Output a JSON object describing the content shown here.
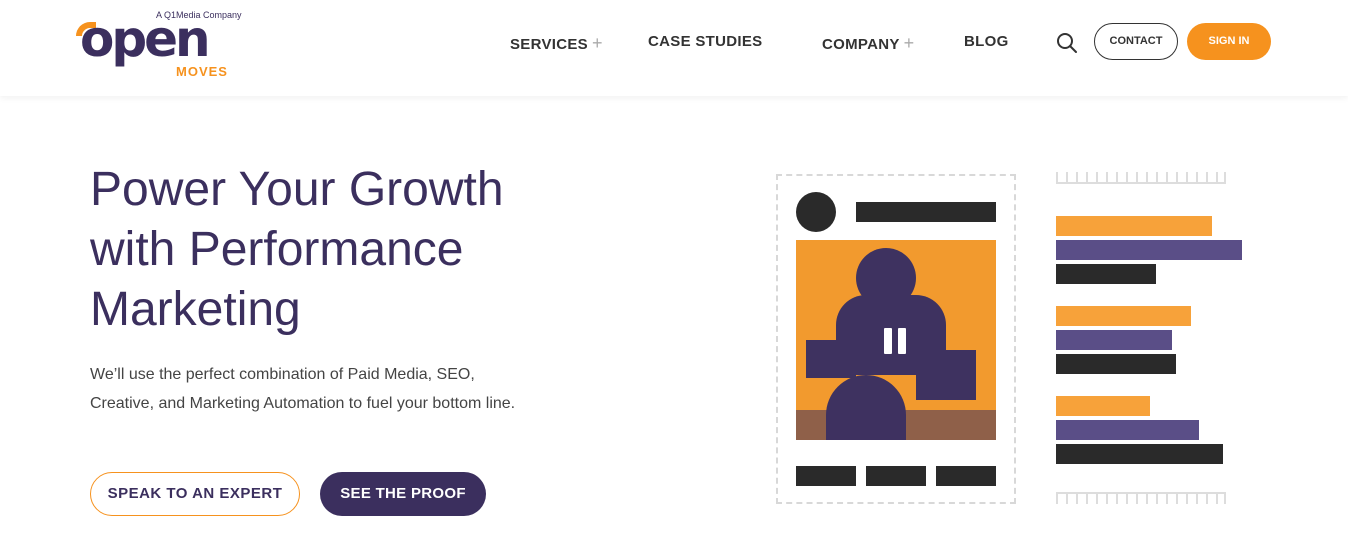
{
  "brand": {
    "tagline": "A Q1Media Company",
    "wordmark": "open",
    "submark": "MOVES",
    "primary_color": "#3b2f5e",
    "accent_color": "#f6921e"
  },
  "nav": {
    "items": [
      {
        "label": "SERVICES",
        "has_submenu": true
      },
      {
        "label": "CASE STUDIES",
        "has_submenu": false
      },
      {
        "label": "COMPANY",
        "has_submenu": true
      },
      {
        "label": "BLOG",
        "has_submenu": false
      }
    ],
    "plus_glyph": "+",
    "search_icon": "search-icon",
    "contact_label": "CONTACT",
    "signin_label": "SIGN IN"
  },
  "hero": {
    "title_lines": [
      "Power Your Growth",
      "with Performance",
      "Marketing"
    ],
    "subtitle_lines": [
      "We’ll use the perfect combination of Paid Media, SEO,",
      "Creative, and Marketing Automation to fuel your bottom line."
    ],
    "cta_primary": "SPEAK TO AN EXPERT",
    "cta_secondary": "SEE THE PROOF"
  },
  "illustration": {
    "video_icon": "pause-icon"
  }
}
